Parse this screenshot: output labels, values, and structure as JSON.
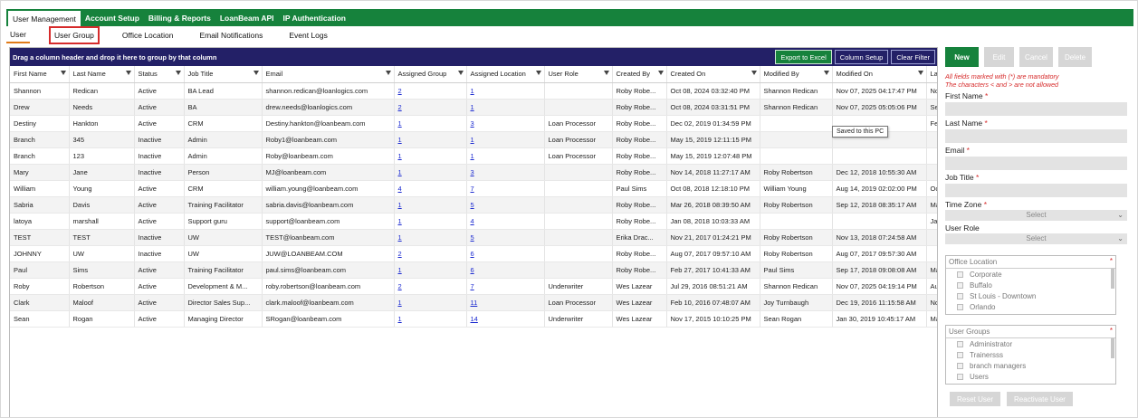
{
  "topnav": [
    {
      "label": "User Management",
      "active": true
    },
    {
      "label": "Account Setup",
      "active": false
    },
    {
      "label": "Billing & Reports",
      "active": false
    },
    {
      "label": "LoanBeam API",
      "active": false
    },
    {
      "label": "IP Authentication",
      "active": false
    }
  ],
  "subnav": [
    {
      "label": "User",
      "state": "active"
    },
    {
      "label": "User Group",
      "state": "boxed"
    },
    {
      "label": "Office Location",
      "state": ""
    },
    {
      "label": "Email Notifications",
      "state": ""
    },
    {
      "label": "Event Logs",
      "state": ""
    }
  ],
  "grid": {
    "group_hint": "Drag a column header and drop it here to group by that column",
    "buttons": {
      "export": "Export to Excel",
      "column_setup": "Column Setup",
      "clear_filter": "Clear Filter"
    },
    "columns": [
      "First Name",
      "Last Name",
      "Status",
      "Job Title",
      "Email",
      "Assigned Group",
      "Assigned Location",
      "User Role",
      "Created By",
      "Created On",
      "Modified By",
      "Modified On",
      "Last"
    ],
    "rows": [
      [
        "Shannon",
        "Redican",
        "Active",
        "BA Lead",
        "shannon.redican@loanlogics.com",
        "2",
        "1",
        "",
        "Roby Robe...",
        "Oct 08, 2024 03:32:40 PM",
        "Shannon Redican",
        "Nov 07, 2025 04:17:47 PM",
        "Nov"
      ],
      [
        "Drew",
        "Needs",
        "Active",
        "BA",
        "drew.needs@loanlogics.com",
        "2",
        "1",
        "",
        "Roby Robe...",
        "Oct 08, 2024 03:31:51 PM",
        "Shannon Redican",
        "Nov 07, 2025 05:05:06 PM",
        "Sep"
      ],
      [
        "Destiny",
        "Hankton",
        "Active",
        "CRM",
        "Destiny.hankton@loanbeam.com",
        "1",
        "3",
        "Loan Processor",
        "Roby Robe...",
        "Dec 02, 2019 01:34:59 PM",
        "",
        "",
        "Feb"
      ],
      [
        "Branch",
        "345",
        "Inactive",
        "Admin",
        "Roby1@loanbeam.com",
        "1",
        "1",
        "Loan Processor",
        "Roby Robe...",
        "May 15, 2019 12:11:15 PM",
        "",
        "",
        ""
      ],
      [
        "Branch",
        "123",
        "Inactive",
        "Admin",
        "Roby@loanbeam.com",
        "1",
        "1",
        "Loan Processor",
        "Roby Robe...",
        "May 15, 2019 12:07:48 PM",
        "",
        "",
        ""
      ],
      [
        "Mary",
        "Jane",
        "Inactive",
        "Person",
        "MJ@loanbeam.com",
        "1",
        "3",
        "",
        "Roby Robe...",
        "Nov 14, 2018 11:27:17 AM",
        "Roby Robertson",
        "Dec 12, 2018 10:55:30 AM",
        ""
      ],
      [
        "William",
        "Young",
        "Active",
        "CRM",
        "william.young@loanbeam.com",
        "4",
        "7",
        "",
        "Paul Sims",
        "Oct 08, 2018 12:18:10 PM",
        "William Young",
        "Aug 14, 2019 02:02:00 PM",
        "Oct"
      ],
      [
        "Sabria",
        "Davis",
        "Active",
        "Training Facilitator",
        "sabria.davis@loanbeam.com",
        "1",
        "5",
        "",
        "Roby Robe...",
        "Mar 26, 2018 08:39:50 AM",
        "Roby Robertson",
        "Sep 12, 2018 08:35:17 AM",
        "Mar"
      ],
      [
        "latoya",
        "marshall",
        "Active",
        "Support guru",
        "support@loanbeam.com",
        "1",
        "4",
        "",
        "Roby Robe...",
        "Jan 08, 2018 10:03:33 AM",
        "",
        "",
        "Jan"
      ],
      [
        "TEST",
        "TEST",
        "Inactive",
        "UW",
        "TEST@loanbeam.com",
        "1",
        "5",
        "",
        "Erika Drac...",
        "Nov 21, 2017 01:24:21 PM",
        "Roby Robertson",
        "Nov 13, 2018 07:24:58 AM",
        ""
      ],
      [
        "JOHNNY",
        "UW",
        "Inactive",
        "UW",
        "JUW@LOANBEAM.COM",
        "2",
        "6",
        "",
        "Roby Robe...",
        "Aug 07, 2017 09:57:10 AM",
        "Roby Robertson",
        "Aug 07, 2017 09:57:30 AM",
        ""
      ],
      [
        "Paul",
        "Sims",
        "Active",
        "Training Facilitator",
        "paul.sims@loanbeam.com",
        "1",
        "6",
        "",
        "Roby Robe...",
        "Feb 27, 2017 10:41:33 AM",
        "Paul Sims",
        "Sep 17, 2018 09:08:08 AM",
        "May"
      ],
      [
        "Roby",
        "Robertson",
        "Active",
        "Development & M...",
        "roby.robertson@loanbeam.com",
        "2",
        "7",
        "Underwriter",
        "Wes Lazear",
        "Jul 29, 2016 08:51:21 AM",
        "Shannon Redican",
        "Nov 07, 2025 04:19:14 PM",
        "Aug"
      ],
      [
        "Clark",
        "Maloof",
        "Active",
        "Director Sales Sup...",
        "clark.maloof@loanbeam.com",
        "1",
        "11",
        "Loan Processor",
        "Wes Lazear",
        "Feb 10, 2016 07:48:07 AM",
        "Joy Turnbaugh",
        "Dec 19, 2016 11:15:58 AM",
        "Nov"
      ],
      [
        "Sean",
        "Rogan",
        "Active",
        "Managing Director",
        "SRogan@loanbeam.com",
        "1",
        "14",
        "Underwriter",
        "Wes Lazear",
        "Nov 17, 2015 10:10:25 PM",
        "Sean Rogan",
        "Jan 30, 2019 10:45:17 AM",
        "May"
      ]
    ]
  },
  "tooltip": "Saved to this PC",
  "form": {
    "buttons": {
      "new": "New",
      "edit": "Edit",
      "cancel": "Cancel",
      "delete": "Delete"
    },
    "note_line1": "All fields marked with (*) are mandatory",
    "note_line2": "The characters < and > are not allowed",
    "first_name": "First Name",
    "last_name": "Last Name",
    "email": "Email",
    "job_title": "Job Title",
    "time_zone": "Time Zone",
    "time_zone_value": "Select",
    "user_role": "User Role",
    "user_role_value": "Select",
    "required_mark": "*",
    "office_location": {
      "title": "Office Location",
      "items": [
        "Corporate",
        "Buffalo",
        "St Louis - Downtown",
        "Orlando"
      ]
    },
    "user_groups": {
      "title": "User Groups",
      "items": [
        "Administrator",
        "Trainersss",
        "branch managers",
        "Users"
      ]
    },
    "reset_user": "Reset User",
    "reactivate_user": "Reactivate User"
  }
}
